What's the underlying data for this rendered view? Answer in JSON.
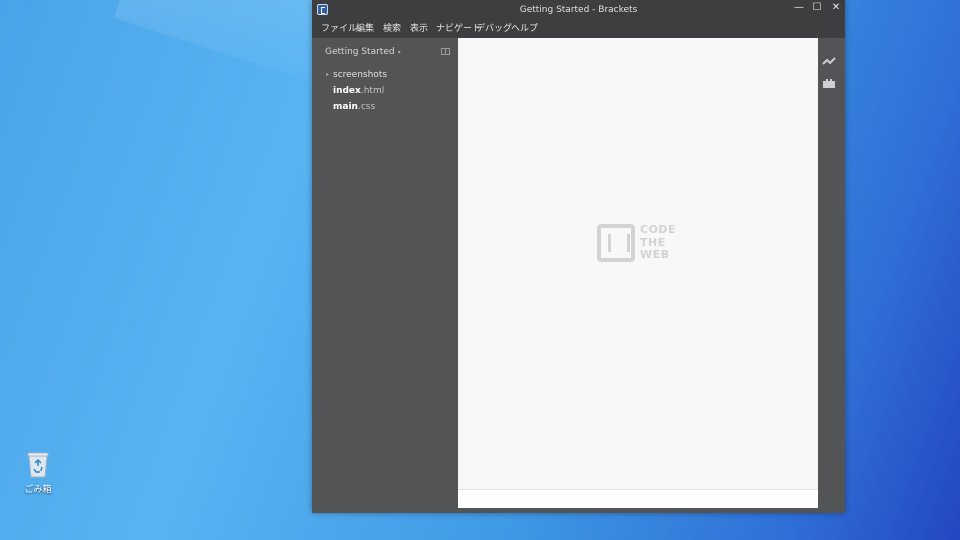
{
  "desktop": {
    "recycle_bin_label": "ごみ箱"
  },
  "window": {
    "title": "Getting Started - Brackets",
    "controls": {
      "minimize": "—",
      "maximize": "☐",
      "close": "✕"
    }
  },
  "menu": {
    "items": [
      "ファイル",
      "編集",
      "検索",
      "表示",
      "ナビゲート",
      "デバッグ",
      "ヘルプ"
    ]
  },
  "sidebar": {
    "project_title": "Getting Started",
    "project_caret": "▾",
    "tree": [
      {
        "name": "screenshots",
        "type": "folder",
        "arrow": "▸"
      },
      {
        "base": "index",
        "ext": ".html",
        "type": "file"
      },
      {
        "base": "main",
        "ext": ".css",
        "type": "file"
      }
    ]
  },
  "editor": {
    "logo_words": [
      "CODE",
      "THE",
      "WEB"
    ]
  },
  "right_toolbar": {
    "icons": [
      "live-preview-icon",
      "extension-manager-icon"
    ]
  },
  "colors": {
    "window_bg": "#535455",
    "titlebar_bg": "#3d3e40",
    "editor_bg": "#f8f8f8",
    "logo_color": "#d3d3d3"
  }
}
